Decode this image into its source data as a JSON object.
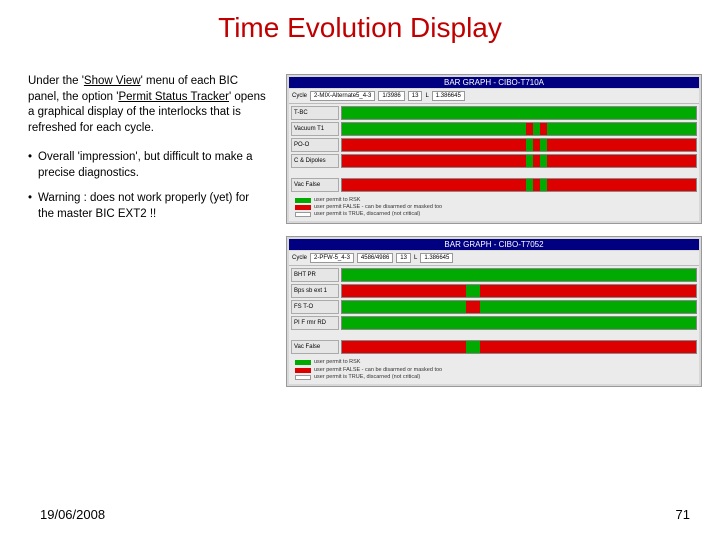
{
  "title": "Time Evolution Display",
  "body": {
    "para1_a": "Under the '",
    "para1_u1": "Show View",
    "para1_b": "' menu of each BIC panel, the option '",
    "para1_u2": "Permit Status Tracker",
    "para1_c": "' opens a graphical display of the interlocks that is refreshed for each cycle.",
    "bullet1": "Overall 'impression', but difficult to make a precise diagnostics.",
    "bullet2": "Warning : does not work properly (yet) for the master BIC EXT2 !!"
  },
  "panel1": {
    "header": "BAR GRAPH - CIBO-T710A",
    "toolbar": {
      "f1": "2-MIX-Alternate5_4-3",
      "f2": "1/3986",
      "f3": "13",
      "f4": "1.386645"
    },
    "rows": [
      "T-BC",
      "Vacuum T1",
      "PO-O",
      "C & Dipoles",
      "Vac False"
    ],
    "legend": {
      "l1": "user permit to RSK",
      "l2": "user permit FALSE - can be disarmed or masked too",
      "l3": "user permit is TRUE, discarned (not critical)"
    }
  },
  "panel2": {
    "header": "BAR GRAPH - CIBO-T7052",
    "toolbar": {
      "f1": "2-PFW-5_4-3",
      "f2": "4586/4986",
      "f3": "13",
      "f4": "1.386645"
    },
    "rows": [
      "BHT PR",
      "Bps sb ext 1",
      "FS T-O",
      "PI F rmr RD",
      "Vac False"
    ],
    "legend": {
      "l1": "user permit to RSK",
      "l2": "user permit FALSE - can be disarmed or masked too",
      "l3": "user permit is TRUE, discarned (not critical)"
    }
  },
  "footer": {
    "date": "19/06/2008",
    "page": "71"
  }
}
